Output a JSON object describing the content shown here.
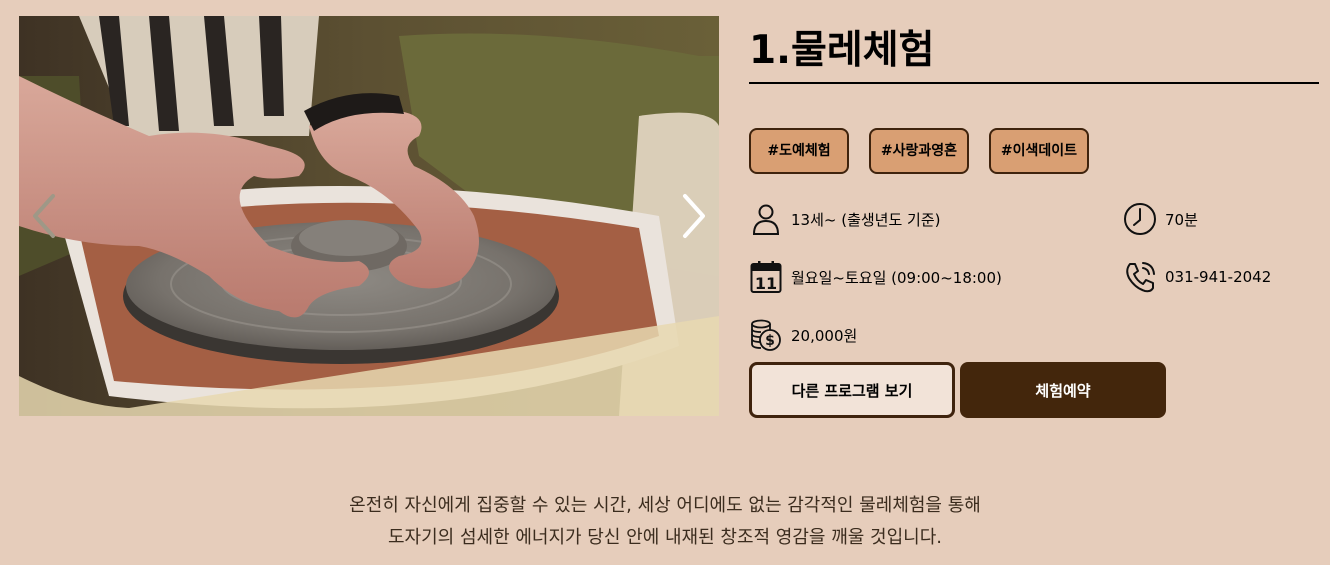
{
  "slider": {
    "prev_icon": "chevron-left-icon",
    "next_icon": "chevron-right-icon",
    "photo": "pottery-wheel-hands-photo"
  },
  "program": {
    "title": "1.물레체험",
    "tags": [
      "#도예체험",
      "#사랑과영혼",
      "#이색데이트"
    ],
    "age": "13세~ (출생년도 기준)",
    "duration": "70분",
    "schedule": "월요일~토요일 (09:00~18:00)",
    "phone": "031-941-2042",
    "price": "20,000원",
    "calendar_day": "11"
  },
  "buttons": {
    "other_programs": "다른 프로그램 보기",
    "reserve": "체험예약"
  },
  "description": {
    "line1": "온전히 자신에게 집중할 수 있는 시간, 세상 어디에도 없는 감각적인 물레체험을 통해",
    "line2": "도자기의 섬세한 에너지가 당신 안에 내재된 창조적 영감을 깨울 것입니다."
  },
  "colors": {
    "background": "#e6cdbb",
    "tag_fill": "#d99f73",
    "brown_dark": "#43260c"
  }
}
